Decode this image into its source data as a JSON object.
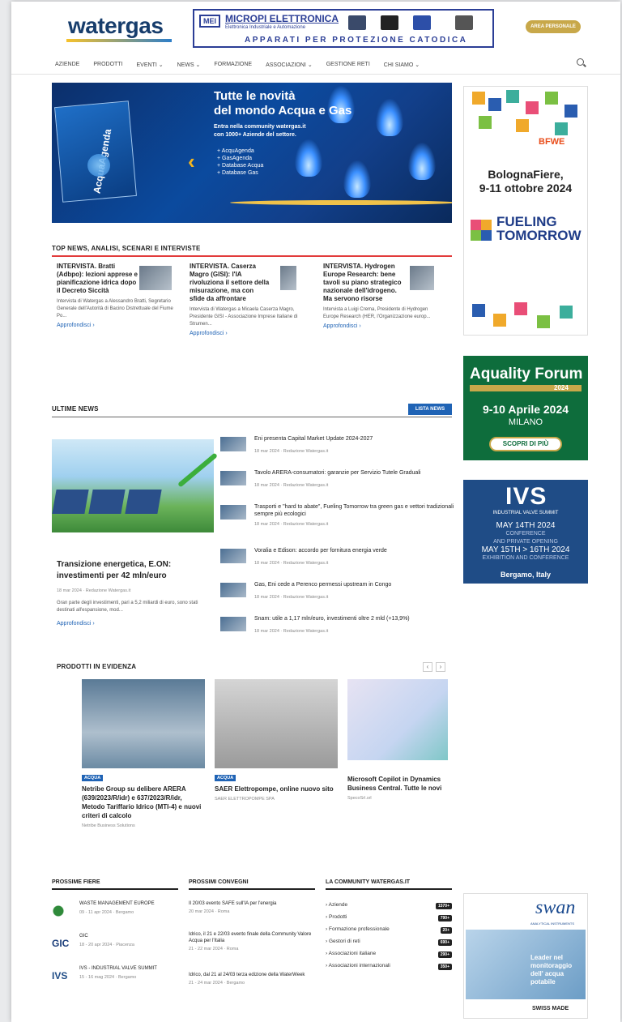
{
  "brand": {
    "logo": "watergas"
  },
  "banner": {
    "mark": "MEI",
    "company": "MICROPI ELETTRONICA",
    "subtitle": "Elettronica Industriale e Automazione",
    "tagline": "APPARATI PER PROTEZIONE CATODICA"
  },
  "header": {
    "area_button": "AREA PERSONALE"
  },
  "nav": {
    "items": [
      "AZIENDE",
      "PRODOTTI",
      "EVENTI ⌄",
      "NEWS ⌄",
      "FORMAZIONE",
      "ASSOCIAZIONI ⌄",
      "GESTIONE RETI",
      "CHI SIAMO ⌄"
    ]
  },
  "hero": {
    "magazine": "AcquaAgenda",
    "title_line1": "Tutte le novità",
    "title_line2": "del mondo Acqua e Gas",
    "sub_line1": "Entra nella community watergas.it",
    "sub_line2": "con 1000+ Aziende del settore.",
    "list": [
      "+ AcquAgenda",
      "+ GasAgenda",
      "+ Database Acqua",
      "+ Database Gas"
    ]
  },
  "top_news": {
    "title": "TOP NEWS, ANALISI, SCENARI E INTERVISTE",
    "items": [
      {
        "heading": "INTERVISTA. Bratti (Adbpo): lezioni apprese e pianificazione idrica dopo il Decreto Siccità",
        "text": "Intervista di Watergas a Alessandro Bratti, Segretario Generale dell'Autorità di Bacino Distrettuale del Fiume Po...",
        "more": "Approfondisci ›"
      },
      {
        "heading": "INTERVISTA. Caserza Magro (GISI): l'IA rivoluziona il settore della misurazione, ma con sfide da affrontare",
        "text": "Intervista di Watergas a Micaela Caserza Magro, Presidente GISI - Associazione Imprese Italiane di Strumen...",
        "more": "Approfondisci ›"
      },
      {
        "heading": "INTERVISTA. Hydrogen Europe Research: bene tavoli su piano strategico nazionale dell'idrogeno. Ma servono risorse",
        "text": "Intervista a Luigi Crema, Presidente di Hydrogen Europe Research (HER, l'Organizzazione europ...",
        "more": "Approfondisci ›"
      }
    ]
  },
  "latest": {
    "title": "ULTIME NEWS",
    "button": "LISTA NEWS",
    "featured": {
      "title": "Transizione energetica, E.ON: investimenti per 42 mln/euro",
      "date": "18 mar 2024",
      "author": "Redazione Watergas.it",
      "text": "Gran parte degli investimenti, pari a 5,2 miliardi di euro, sono stati destinati all'espansione, mod...",
      "more": "Approfondisci ›"
    },
    "items": [
      {
        "title": "Eni presenta Capital Market Update 2024-2027",
        "date": "18 mar 2024",
        "author": "Redazione Watergas.it"
      },
      {
        "title": "Tavolo ARERA-consumatori: garanzie per Servizio Tutele Graduali",
        "date": "18 mar 2024",
        "author": "Redazione Watergas.it"
      },
      {
        "title": "Trasporti e \"hard to abate\", Fueling Tomorrow tra green gas e vettori tradizionali sempre più ecologici",
        "date": "18 mar 2024",
        "author": "Redazione Watergas.it"
      },
      {
        "title": "Voralia e Edison: accordo per fornitura energia verde",
        "date": "18 mar 2024",
        "author": "Redazione Watergas.it"
      },
      {
        "title": "Gas, Eni cede a Perenco permessi upstream in Congo",
        "date": "18 mar 2024",
        "author": "Redazione Watergas.it"
      },
      {
        "title": "Snam: utile a 1,17 mln/euro, investimenti oltre 2 mld (+13,9%)",
        "date": "18 mar 2024",
        "author": "Redazione Watergas.it"
      }
    ]
  },
  "products": {
    "title": "PRODOTTI IN EVIDENZA",
    "items": [
      {
        "tag": "ACQUA",
        "title": "Netribe Group su delibere ARERA (639/2023/R/idr) e 637/2023/R/idr, Metodo Tariffario Idrico (MTI-4) e nuovi criteri di calcolo",
        "author": "Netribe Business Solutions"
      },
      {
        "tag": "ACQUA",
        "title": "SAER Elettropompe, online nuovo sito",
        "author": "SAER ELETTROPOMPE SPA"
      },
      {
        "tag": "",
        "title": "Microsoft Copilot in Dynamics Business Central. Tutte le novi",
        "author": "SpecoSrl.srl"
      }
    ]
  },
  "fairs": {
    "title": "PROSSIME FIERE",
    "items": [
      {
        "name": "WASTE MANAGEMENT EUROPE",
        "dates": "09 - 11 apr 2024",
        "place": "Bergamo"
      },
      {
        "name": "GIC",
        "dates": "18 - 20 apr 2024",
        "place": "Piacenza"
      },
      {
        "name": "IVS - INDUSTRIAL VALVE SUMMIT",
        "dates": "15 - 16 mag 2024",
        "place": "Bergamo"
      }
    ]
  },
  "conventions": {
    "title": "PROSSIMI CONVEGNI",
    "items": [
      {
        "name": "Il 20/03 evento SAFE sull'IA per l'energia",
        "dates": "20 mar 2024",
        "place": "Roma"
      },
      {
        "name": "Idrico, il 21 e 22/03 evento finale della Community Valore Acqua per l'Italia",
        "dates": "21 - 22 mar 2024",
        "place": "Roma"
      },
      {
        "name": "Idrico, dal 21 al 24/03 terza edizione della WaterWeek",
        "dates": "21 - 24 mar 2024",
        "place": "Bergamo"
      }
    ]
  },
  "community": {
    "title": "LA COMMUNITY WATERGAS.IT",
    "items": [
      {
        "label": "Aziende",
        "count": "1570+"
      },
      {
        "label": "Prodotti",
        "count": "790+"
      },
      {
        "label": "Formazione professionale",
        "count": "20+"
      },
      {
        "label": "Gestori di reti",
        "count": "690+"
      },
      {
        "label": "Associazioni italiane",
        "count": "290+"
      },
      {
        "label": "Associazioni internazionali",
        "count": "350+"
      }
    ]
  },
  "ads": {
    "bfwe": {
      "logo": "BFWE",
      "line1": "BolognaFiere,",
      "line2": "9-11 ottobre 2024",
      "brand1": "FUELING",
      "brand2": "TOMORROW"
    },
    "aquality": {
      "title": "Aquality Forum",
      "edition": "2024",
      "dates": "9-10 Aprile 2024",
      "city": "MILANO",
      "cta": "SCOPRI DI PIÙ"
    },
    "ivs": {
      "logo": "IVS",
      "subtitle": "INDUSTRIAL VALVE SUMMIT",
      "line1": "MAY 14TH 2024",
      "line2": "CONFERENCE",
      "line3": "AND PRIVATE OPENING",
      "line4": "MAY 15TH > 16TH 2024",
      "line5": "EXHIBITION AND CONFERENCE",
      "city": "Bergamo, Italy"
    },
    "swan": {
      "logo": "swan",
      "small": "ANALYTICAL INSTRUMENTS",
      "text": "Leader nel monitoraggio dell' acqua potabile",
      "swiss": "SWISS MADE"
    }
  }
}
